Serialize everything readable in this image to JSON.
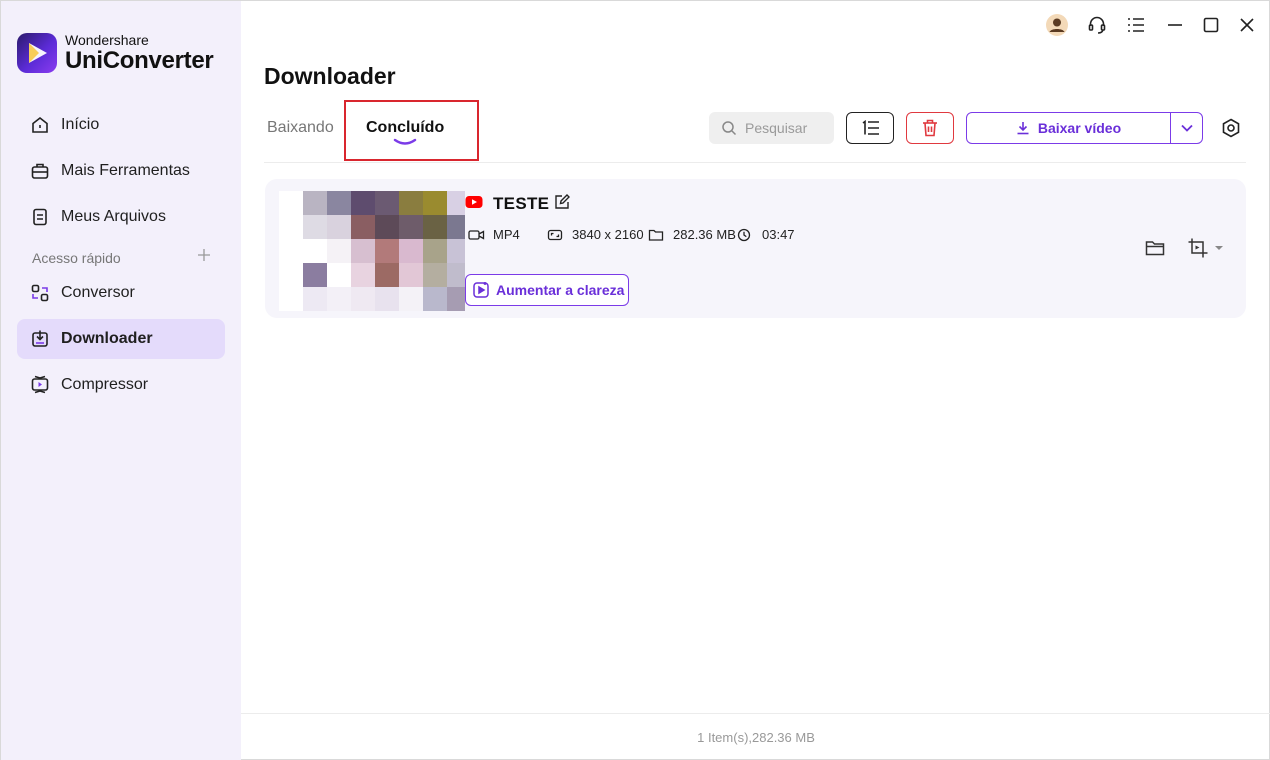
{
  "brand": {
    "small": "Wondershare",
    "big": "UniConverter"
  },
  "sidebar": {
    "items": [
      {
        "label": "Início",
        "icon": "home-icon"
      },
      {
        "label": "Mais Ferramentas",
        "icon": "toolbox-icon"
      },
      {
        "label": "Meus Arquivos",
        "icon": "file-icon"
      }
    ],
    "quick_access_label": "Acesso rápido",
    "quick_items": [
      {
        "label": "Conversor",
        "icon": "converter-icon"
      },
      {
        "label": "Downloader",
        "icon": "downloader-icon",
        "active": true
      },
      {
        "label": "Compressor",
        "icon": "compressor-icon"
      }
    ]
  },
  "header": {
    "title": "Downloader"
  },
  "tabs": [
    {
      "label": "Baixando",
      "active": false
    },
    {
      "label": "Concluído",
      "active": true
    }
  ],
  "toolbar": {
    "search_placeholder": "Pesquisar",
    "download_label": "Baixar vídeo"
  },
  "items": [
    {
      "source_icon": "youtube-icon",
      "title": "TESTE",
      "format": "MP4",
      "resolution": "3840 x 2160",
      "size": "282.36 MB",
      "duration": "03:47",
      "enhance_label": "Aumentar a clareza"
    }
  ],
  "footer": {
    "summary": "1 Item(s),282.36 MB"
  },
  "colors": {
    "accent": "#6a2fd9",
    "sidebar_bg": "#f3f0fb",
    "active_nav_bg": "#e4dbfb",
    "delete_red": "#e0393f",
    "highlight_red": "#d9262e"
  }
}
